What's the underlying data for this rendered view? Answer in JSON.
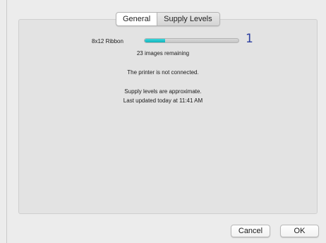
{
  "tabs": [
    {
      "label": "General",
      "selected": false
    },
    {
      "label": "Supply Levels",
      "selected": true
    }
  ],
  "supply": {
    "name": "8x12 Ribbon",
    "level_fraction": 0.22,
    "marker": "1",
    "remaining_text": "23 images remaining",
    "fill_color": "#1fc1c8"
  },
  "messages": {
    "connection": "The printer is not connected.",
    "approximate": "Supply levels are approximate.",
    "updated": "Last updated today at 11:41 AM"
  },
  "buttons": {
    "cancel_label": "Cancel",
    "ok_label": "OK"
  }
}
